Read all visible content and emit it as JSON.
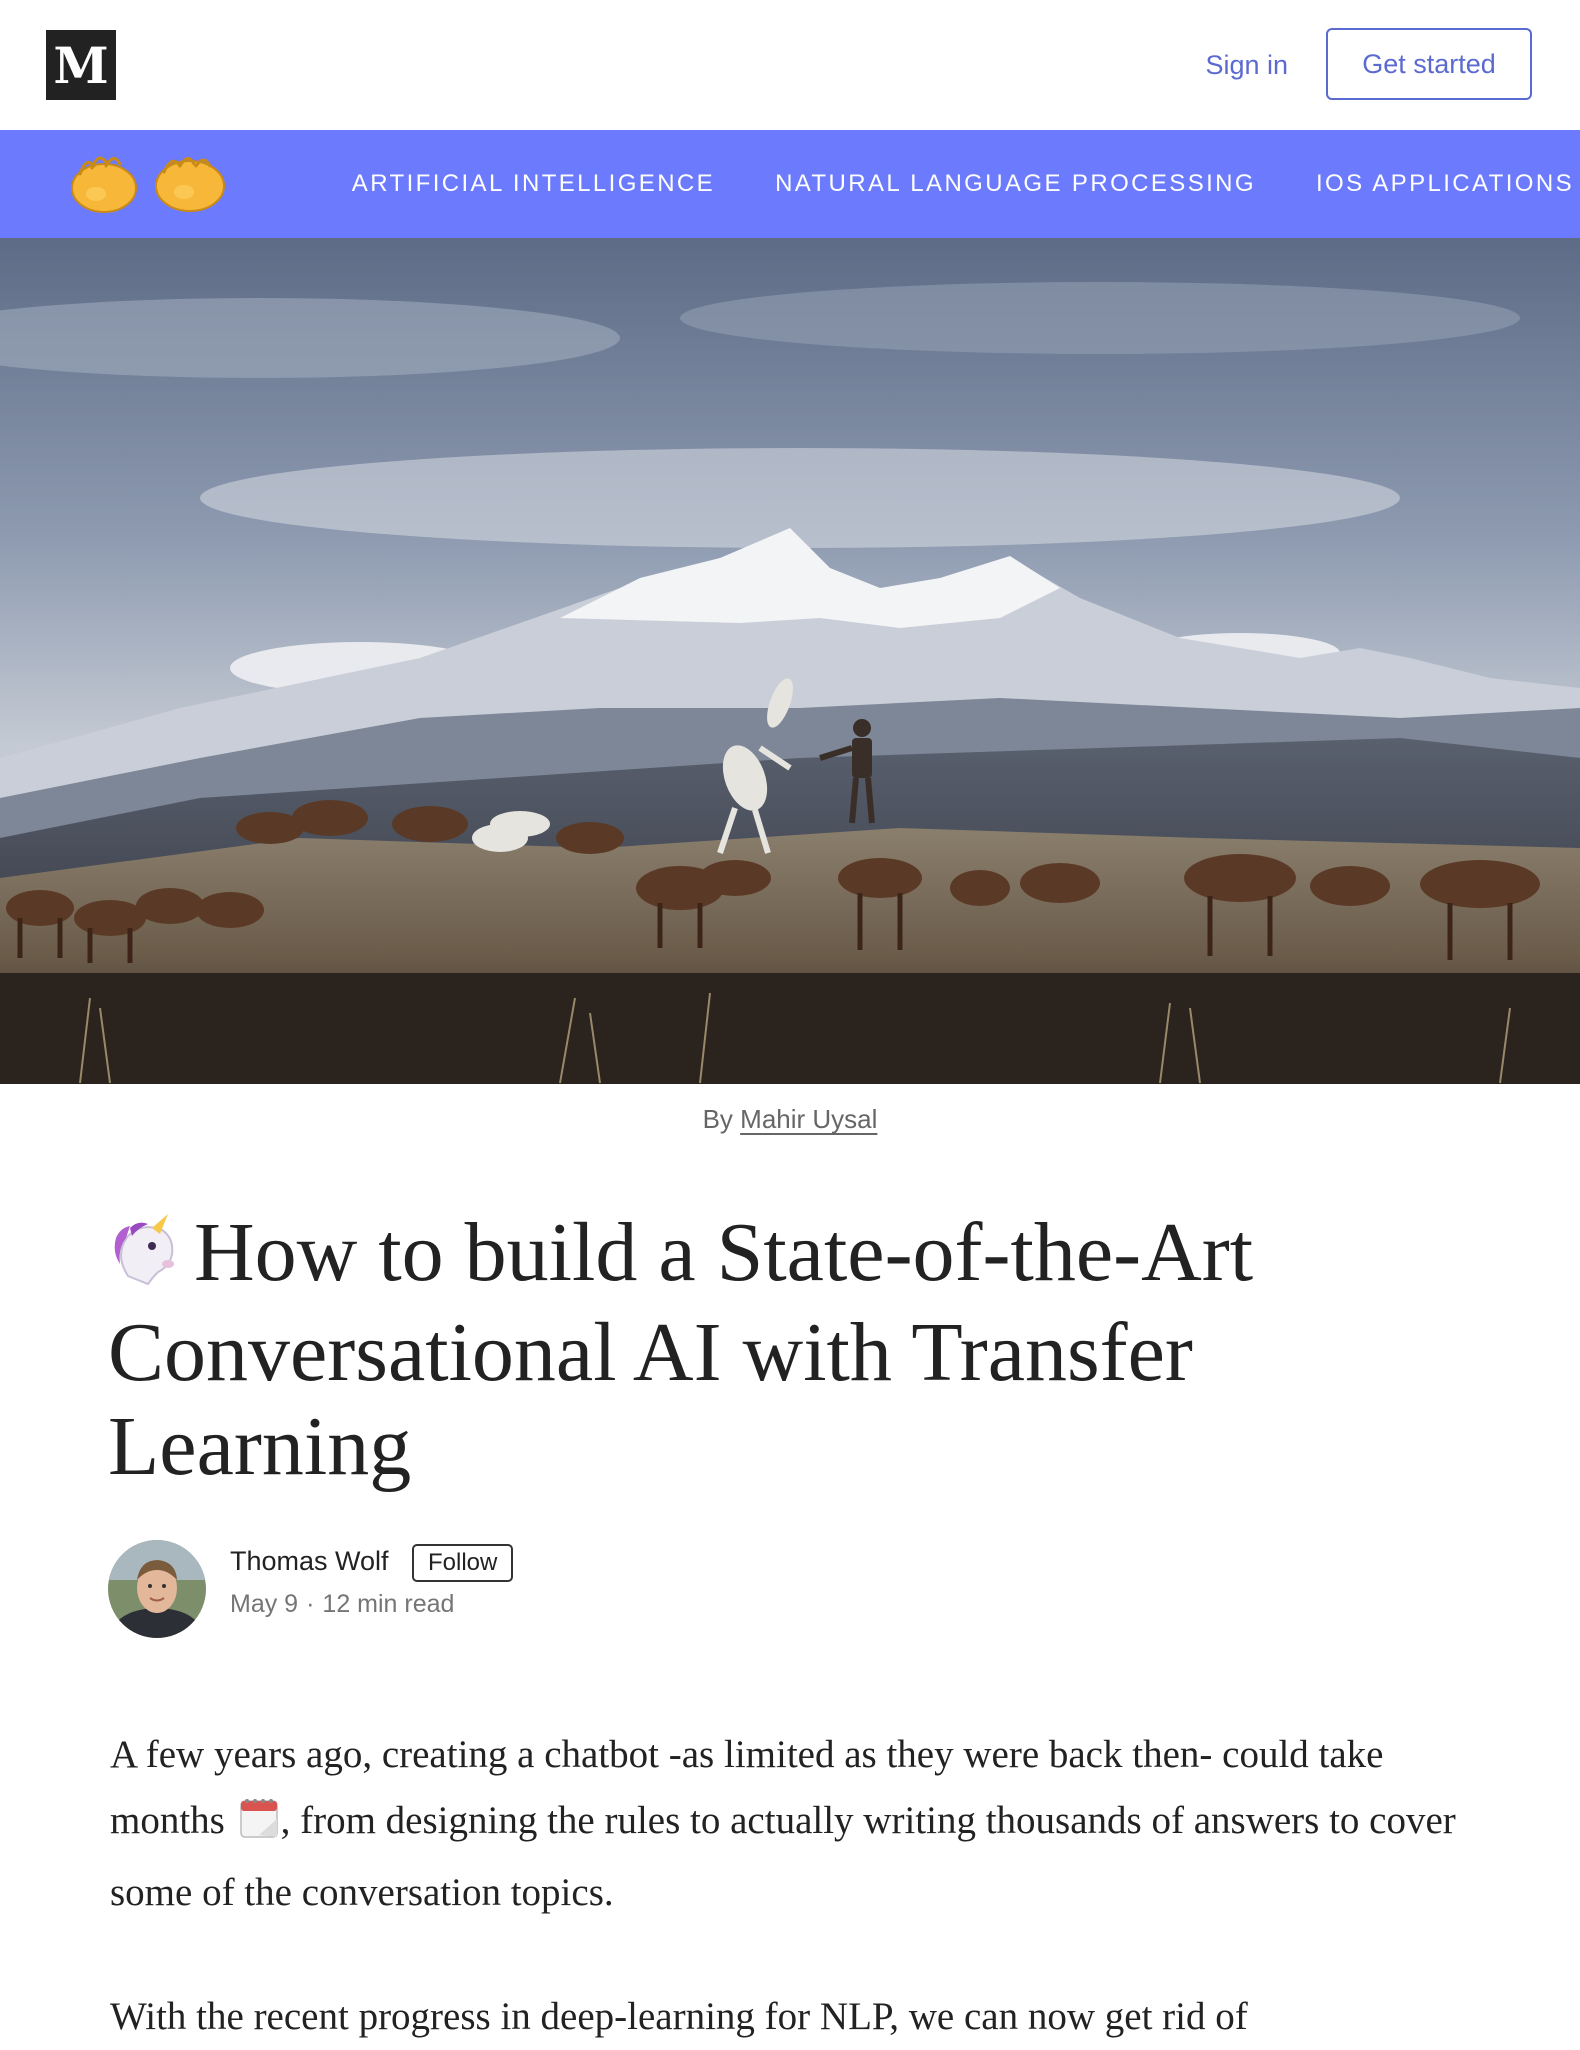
{
  "topbar": {
    "logo": "M",
    "sign_in": "Sign in",
    "get_started": "Get started"
  },
  "pub_nav": {
    "logo_icon": "clapping-hands-icon",
    "links": [
      "ARTIFICIAL INTELLIGENCE",
      "NATURAL LANGUAGE PROCESSING",
      "IOS APPLICATIONS"
    ],
    "background_color": "#6c7bfd"
  },
  "hero": {
    "image_caption_prefix": "By",
    "image_caption_author": "Mahir Uysal"
  },
  "article": {
    "title_icon": "unicorn-icon",
    "title": "How to build a State-of-the-Art Conversational AI with Transfer Learning",
    "author_name": "Thomas Wolf",
    "follow_label": "Follow",
    "date": "May 9",
    "read_time": "12 min read",
    "paragraphs": [
      {
        "before_icon": "A few years ago, creating a chatbot -as limited as they were back then- could take months",
        "icon": "calendar-icon",
        "after_icon": ", from designing the rules to actually writing thousands of answers to cover some of the conversation topics."
      },
      {
        "text": "With the recent progress in deep-learning for NLP, we can now get rid of"
      }
    ]
  },
  "colors": {
    "accent": "#5b6ad0",
    "nav_bar": "#6c7bfd",
    "text": "#222222",
    "muted": "#757575"
  }
}
